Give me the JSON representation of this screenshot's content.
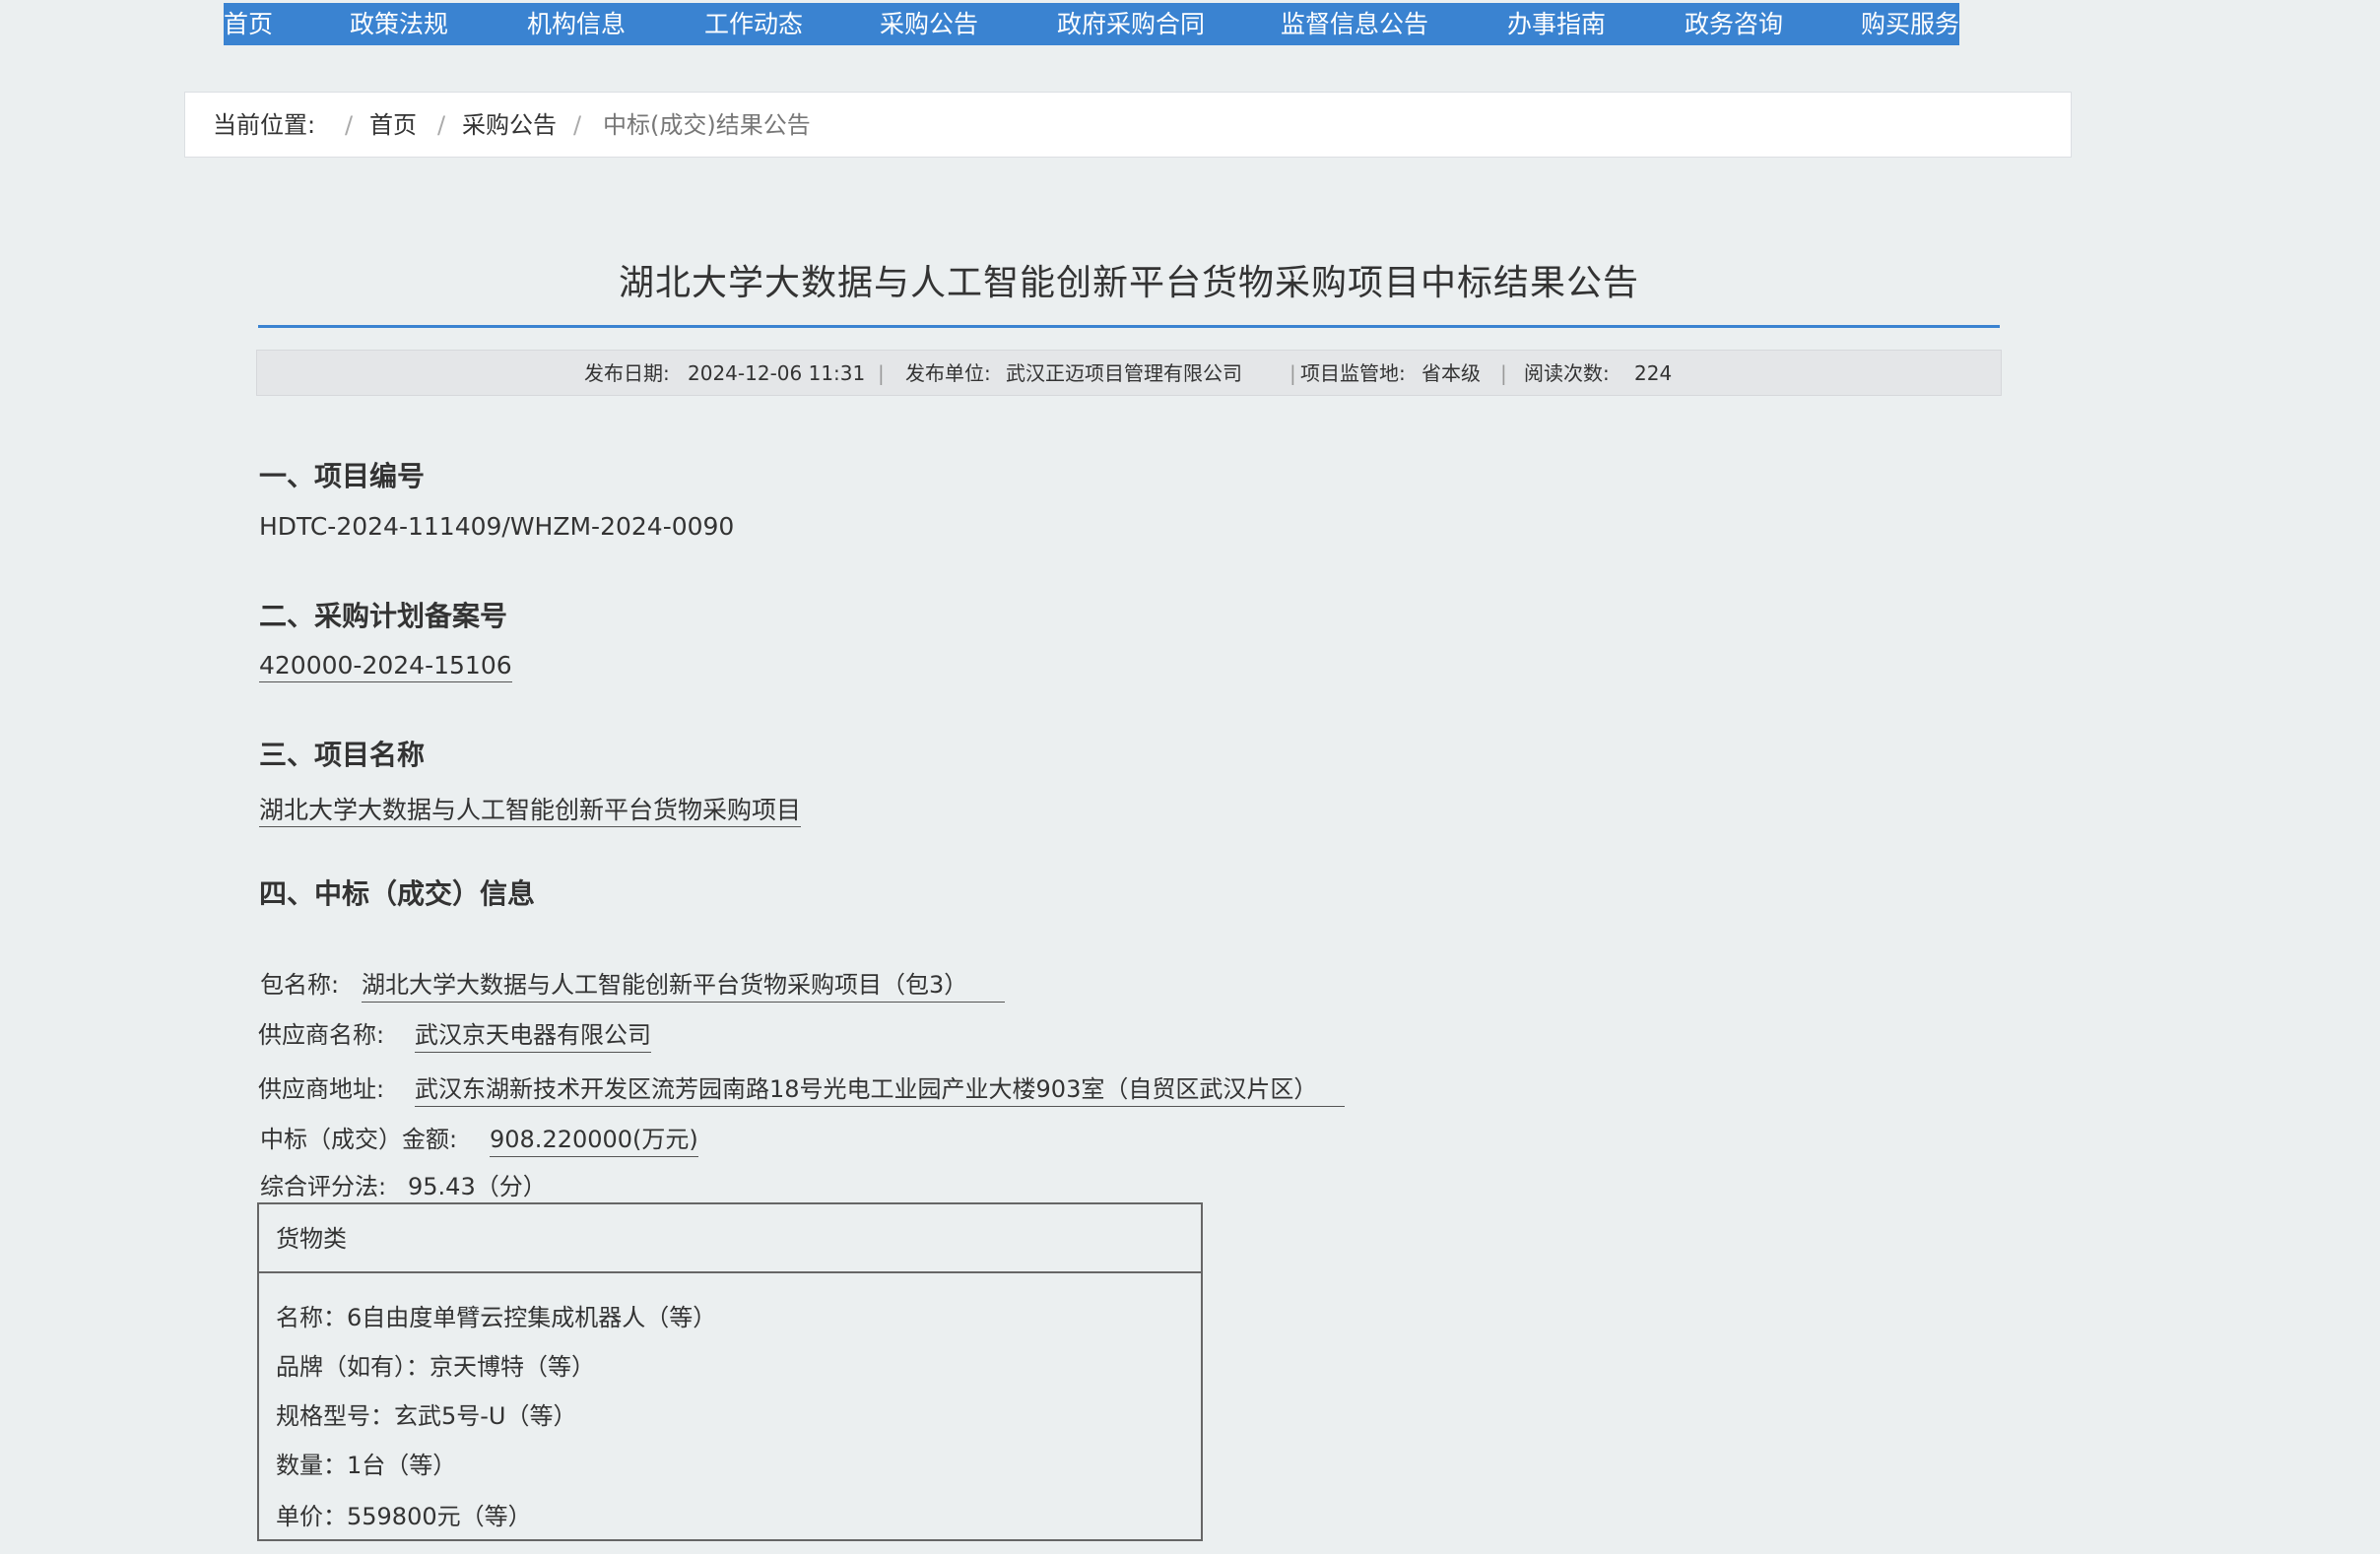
{
  "nav": {
    "items": [
      "首页",
      "政策法规",
      "机构信息",
      "工作动态",
      "采购公告",
      "政府采购合同",
      "监督信息公告",
      "办事指南",
      "政务咨询",
      "购买服务"
    ]
  },
  "breadcrumb": {
    "label": "当前位置:",
    "sep": "/",
    "items": [
      "首页",
      "采购公告",
      "中标(成交)结果公告"
    ]
  },
  "article": {
    "title": "湖北大学大数据与人工智能创新平台货物采购项目中标结果公告",
    "meta": {
      "publish_date_label": "发布日期:",
      "publish_date": "2024-12-06 11:31",
      "publisher_label": "发布单位:",
      "publisher": "武汉正迈项目管理有限公司",
      "supervision_label": "项目监管地:",
      "supervision": "省本级",
      "views_label": "阅读次数:",
      "views": "224",
      "pipe": "|"
    },
    "sections": {
      "s1_heading": "一、项目编号",
      "s1_value": "HDTC-2024-111409/WHZM-2024-0090",
      "s2_heading": "二、采购计划备案号",
      "s2_value": "420000-2024-15106",
      "s3_heading": "三、项目名称",
      "s3_value": "湖北大学大数据与人工智能创新平台货物采购项目",
      "s4_heading": "四、中标（成交）信息"
    },
    "award": {
      "package_label": "包名称:",
      "package_value": "湖北大学大数据与人工智能创新平台货物采购项目（包3）",
      "supplier_label": "供应商名称:",
      "supplier_value": "武汉京天电器有限公司",
      "address_label": "供应商地址:",
      "address_value": "武汉东湖新技术开发区流芳园南路18号光电工业园产业大楼903室（自贸区武汉片区）",
      "amount_label": "中标（成交）金额:",
      "amount_value": "908.220000(万元)",
      "score_label": "综合评分法:",
      "score_value": "95.43（分）"
    },
    "goods": {
      "heading": "货物类",
      "name": "名称：6自由度单臂云控集成机器人（等）",
      "brand": "品牌（如有）：京天博特（等）",
      "model": "规格型号：玄武5号-U（等）",
      "qty": "数量：1台（等）",
      "price": "单价：559800元（等）"
    }
  }
}
